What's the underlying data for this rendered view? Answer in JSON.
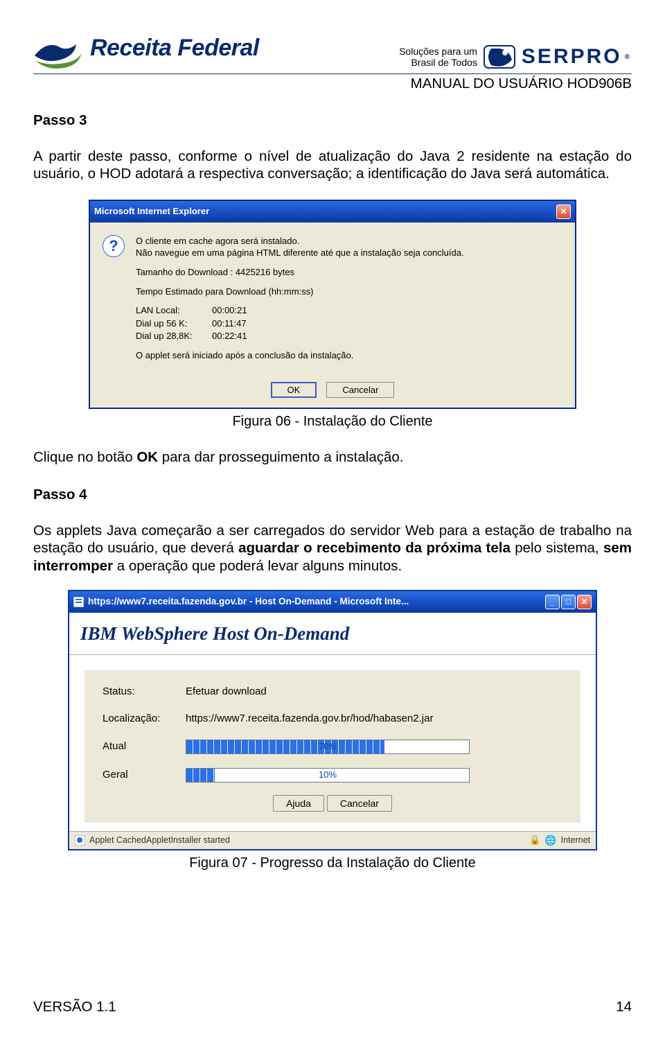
{
  "header": {
    "rf_brand": "Receita Federal",
    "serpro_tag_line1": "Soluções para um",
    "serpro_tag_line2": "Brasil de Todos",
    "serpro_brand": "SERPRO",
    "manual_title": "MANUAL DO USUÁRIO HOD906B"
  },
  "body": {
    "passo3_title": "Passo 3",
    "passo3_text": "A partir deste passo, conforme o nível de atualização do Java 2 residente na estação do usuário, o HOD adotará a respectiva conversação; a identificação do Java será automática.",
    "fig06_caption": "Figura 06 - Instalação do Cliente",
    "click_ok_pre": "Clique no botão ",
    "click_ok_bold": "OK",
    "click_ok_post": " para dar prosseguimento a instalação.",
    "passo4_title": "Passo 4",
    "passo4_pre": "Os applets Java começarão a ser carregados do servidor Web para a estação de trabalho na estação do usuário, que deverá ",
    "passo4_bold": "aguardar o recebimento da próxima tela",
    "passo4_mid": " pelo sistema, ",
    "passo4_bold2": "sem interromper",
    "passo4_post": " a operação que poderá levar alguns minutos.",
    "fig07_caption": "Figura 07 - Progresso da Instalação do Cliente"
  },
  "dialog1": {
    "title": "Microsoft Internet Explorer",
    "line1": "O cliente em cache agora será instalado.",
    "line2": "Não navegue em uma página HTML diferente até que a instalação seja concluída.",
    "size_line": "Tamanho do Download : 4425216 bytes",
    "eta_title": "Tempo Estimado para Download (hh:mm:ss)",
    "rows": [
      {
        "label": "LAN Local:",
        "value": "00:00:21"
      },
      {
        "label": "Dial up 56 K:",
        "value": "00:11:47"
      },
      {
        "label": "Dial up 28,8K:",
        "value": "00:22:41"
      }
    ],
    "post_line": "O applet será iniciado após a conclusão da instalação.",
    "ok": "OK",
    "cancel": "Cancelar"
  },
  "window2": {
    "title": "https://www7.receita.fazenda.gov.br - Host On-Demand - Microsoft Inte...",
    "ibm_title": "IBM WebSphere Host On-Demand",
    "status_label": "Status:",
    "status_value": "Efetuar download",
    "loc_label": "Localização:",
    "loc_value": "https://www7.receita.fazenda.gov.br/hod/habasen2.jar",
    "atual_label": "Atual",
    "atual_pct": "70%",
    "atual_fill": 70,
    "geral_label": "Geral",
    "geral_pct": "10%",
    "geral_fill": 10,
    "help": "Ajuda",
    "cancel": "Cancelar",
    "status_bar_text": "Applet CachedAppletInstaller started",
    "zone": "Internet"
  },
  "footer": {
    "version": "VERSÃO 1.1",
    "page": "14"
  }
}
